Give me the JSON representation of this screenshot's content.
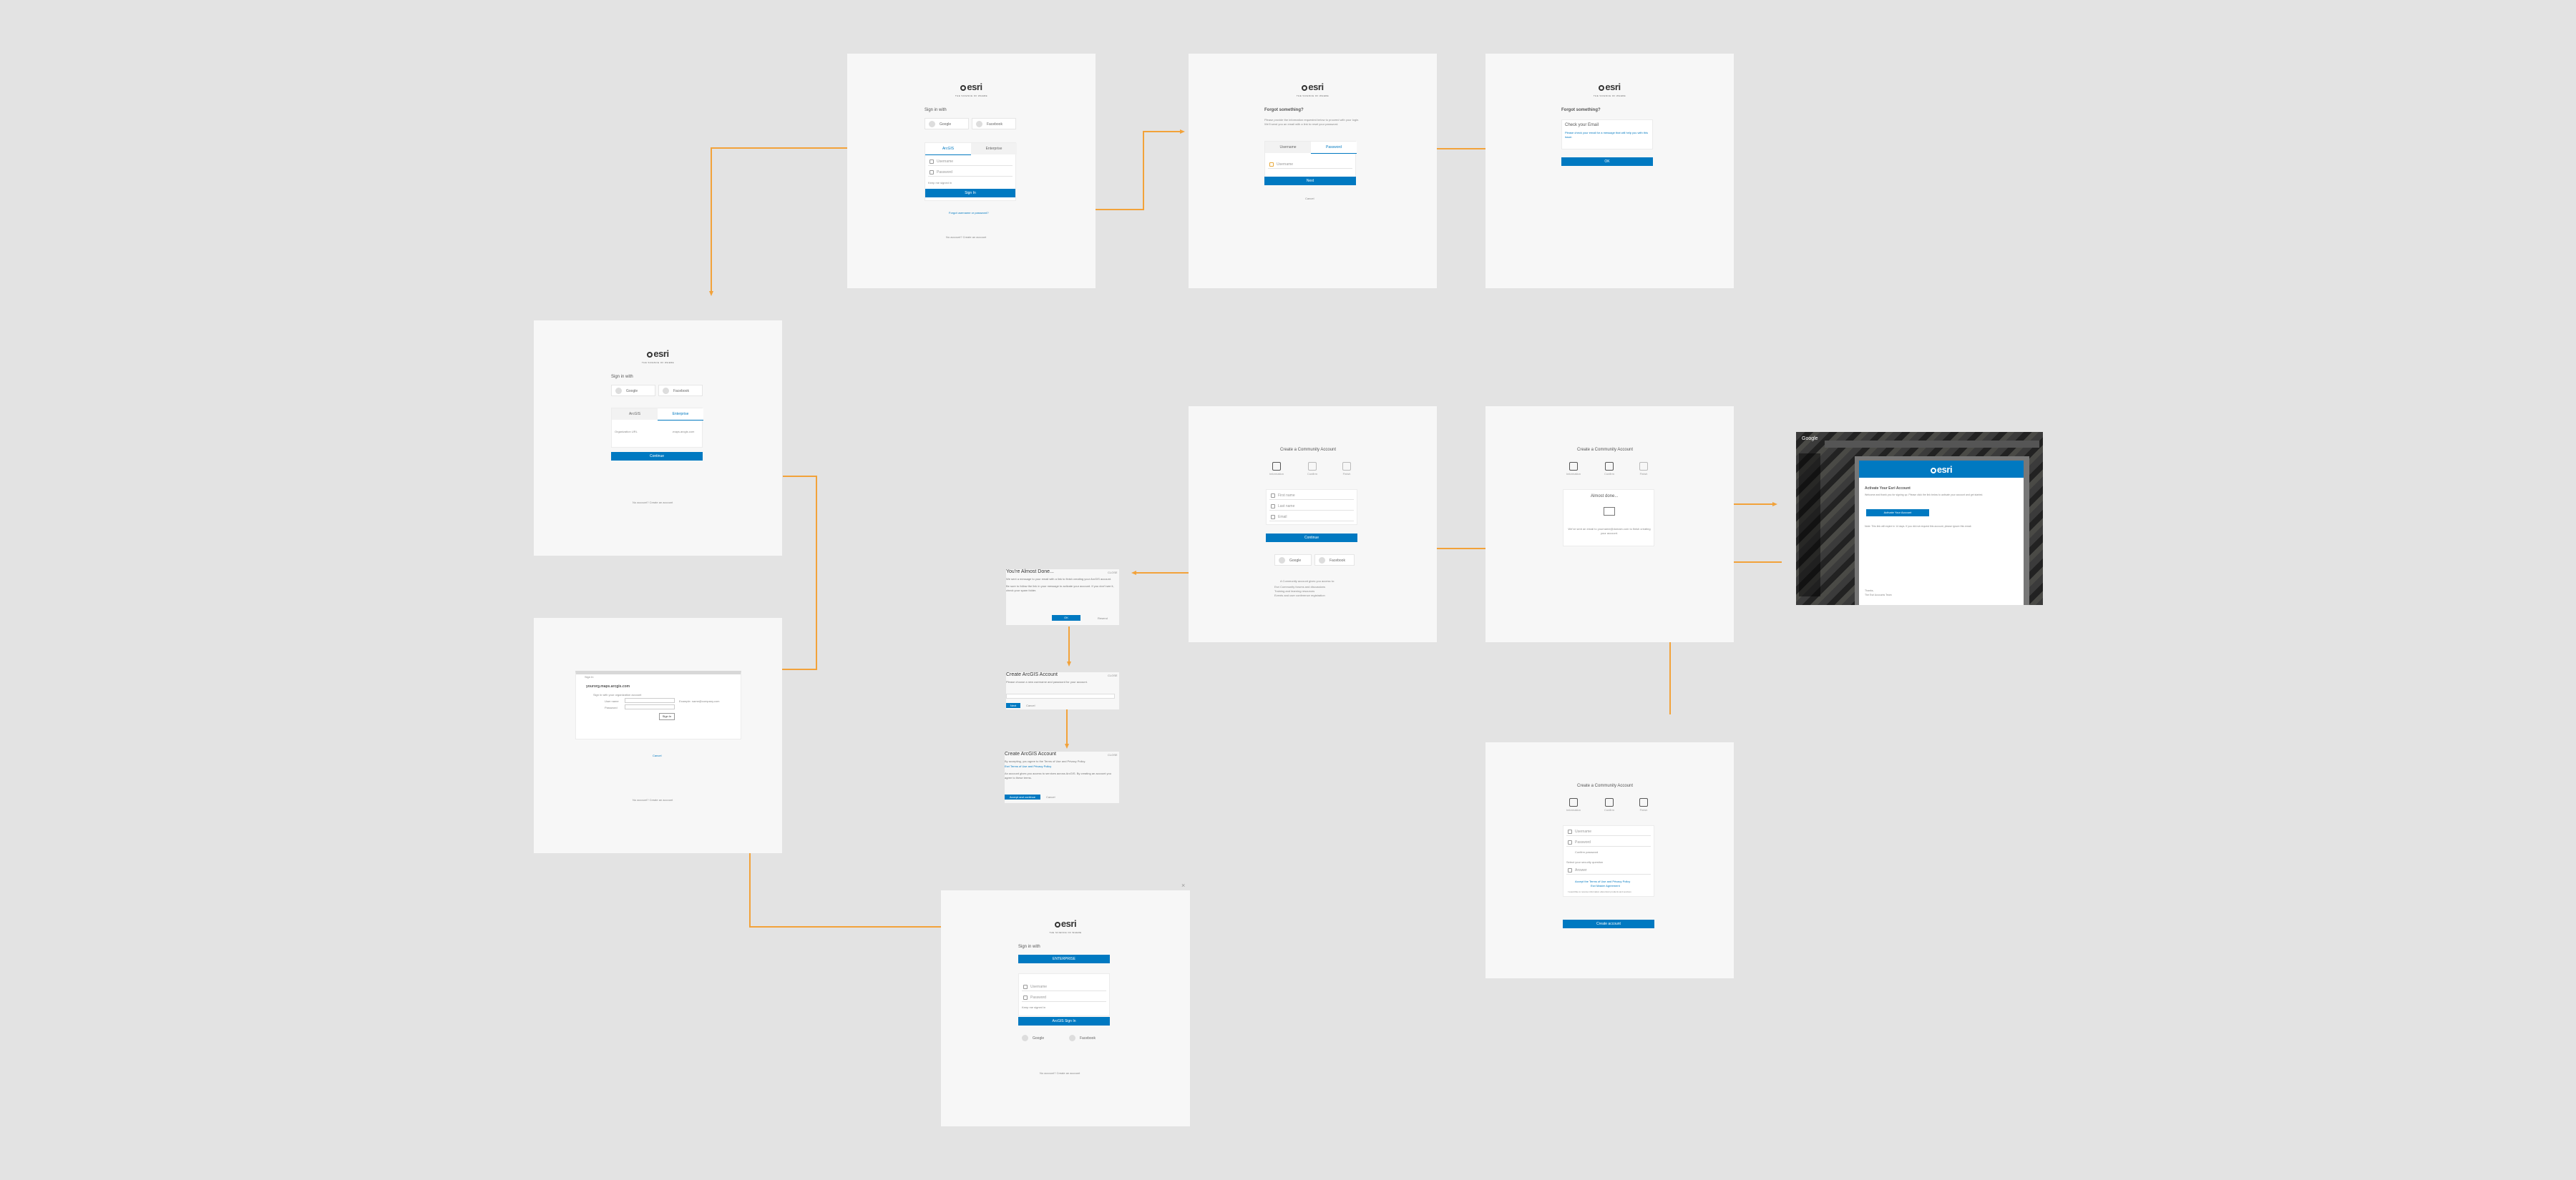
{
  "canvas": {
    "background": "#e3e3e3",
    "connector_color": "#f2a23a",
    "accent": "#0079c1"
  },
  "brand": {
    "logo": "esri",
    "tagline": "THE SCIENCE OF WHERE"
  },
  "frame1": {
    "sign_in_with": "Sign in with",
    "google": "Google",
    "facebook": "Facebook",
    "tab_arcgis": "ArcGIS",
    "tab_enterprise": "Enterprise",
    "username": "Username",
    "password": "Password",
    "keep_signed_in": "Keep me signed in",
    "sign_in": "Sign In",
    "forgot": "Forgot username or password?",
    "no_account": "No account?",
    "create": "Create an account"
  },
  "frame2": {
    "title": "Forgot something?",
    "body": "Please provide the information requested below to proceed with your login. We'll send you an email with a link to reset your password.",
    "tab_username": "Username",
    "tab_password": "Password",
    "field": "Username",
    "next": "Next",
    "cancel": "Cancel"
  },
  "frame3": {
    "title": "Forgot something?",
    "heading": "Check your Email",
    "body": "Please check your email for a message that will help you with this issue.",
    "ok": "OK"
  },
  "frame4": {
    "sign_in_with": "Sign in with",
    "google": "Google",
    "facebook": "Facebook",
    "tab_arcgis": "ArcGIS",
    "tab_enterprise": "Enterprise",
    "org_url": "Organization URL",
    "org_suffix": ".maps.arcgis.com",
    "continue": "Continue",
    "no_account": "No account?",
    "create": "Create an account"
  },
  "frame5": {
    "title": "Sign In",
    "org": "yourorg.maps.arcgis.com",
    "prompt": "Sign in with your organization account",
    "user_name": "User name",
    "password": "Password",
    "hint": "Example: name@company.com",
    "sign_in": "Sign In",
    "cancel": "Cancel",
    "no_account": "No account?",
    "create": "Create an account"
  },
  "frame6": {
    "sign_in_with": "Sign in with",
    "enterprise": "ENTERPRISE",
    "username": "Username",
    "password": "Password",
    "keep_signed_in": "Keep me signed in",
    "sign_in": "ArcGIS Sign In",
    "google": "Google",
    "facebook": "Facebook",
    "no_account": "No account?",
    "create": "Create an account"
  },
  "frame7": {
    "title": "Create a Community Account",
    "steps": [
      "Information",
      "Confirm",
      "Finish"
    ],
    "first_name": "First name",
    "last_name": "Last name",
    "email": "Email",
    "continue": "Continue",
    "google": "Google",
    "facebook": "Facebook",
    "note_heading": "A Community account gives you access to:",
    "notes": [
      "Esri Community forums and discussions",
      "Training and learning resources",
      "Events and user conference registration"
    ]
  },
  "frame8": {
    "title": "Create a Community Account",
    "steps": [
      "Information",
      "Confirm",
      "Finish"
    ],
    "heading": "Almost done...",
    "body": "We've sent an email to yourname@domain.com to finish creating your account."
  },
  "frame9": {
    "title": "Create a Community Account",
    "steps": [
      "Information",
      "Confirm",
      "Finish"
    ],
    "username": "Username",
    "password": "Password",
    "confirm": "Confirm password",
    "question": "Select your security question",
    "answer": "Answer",
    "terms": "Accept the Terms of Use and Privacy Policy",
    "terms2": "Esri Master Agreement",
    "privacy": "I would like to receive information about Esri products and services",
    "create": "Create account"
  },
  "dialog1": {
    "title": "You're Almost Done...",
    "close": "CLOSE",
    "body1": "We sent a message to your email with a link to finish creating your ArcGIS account.",
    "body2": "Be sure to follow the link in your message to activate your account. If you don't see it, check your spam folder.",
    "ok": "OK",
    "resend": "Resend"
  },
  "dialog2": {
    "title": "Create ArcGIS Account",
    "close": "CLOSE",
    "body": "Please choose a new username and password for your account.",
    "next": "Next",
    "cancel": "Cancel"
  },
  "dialog3": {
    "title": "Create ArcGIS Account",
    "close": "CLOSE",
    "body1": "By accepting, you agree to the Terms of Use and Privacy Policy.",
    "link": "Esri Terms of Use and Privacy Policy",
    "body2": "An account gives you access to services across ArcGIS. By creating an account you agree to these terms.",
    "accept": "Accept and continue",
    "cancel": "Cancel"
  },
  "email": {
    "app": "Google",
    "heading": "Activate Your Esri Account",
    "body": "Welcome and thank you for signing up. Please click the link below to activate your account and get started.",
    "button": "Activate Your Account",
    "footer": "Note: This link will expire in 14 days. If you did not request this account, please ignore this email.",
    "sign": "Thanks,",
    "team": "The Esri Accounts Team"
  }
}
